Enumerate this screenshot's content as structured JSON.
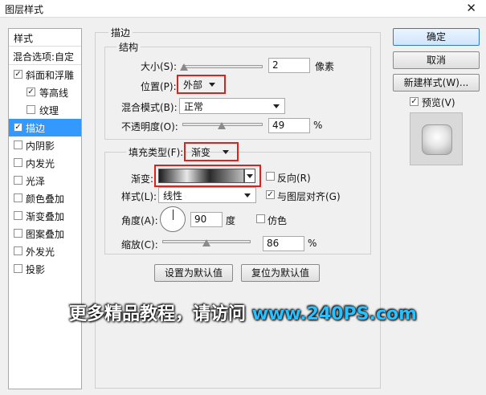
{
  "window": {
    "title": "图层样式",
    "close": "✕"
  },
  "styles_panel": {
    "header": "样式",
    "blend": "混合选项:自定",
    "items": [
      {
        "label": "斜面和浮雕",
        "checked": true,
        "indent": false,
        "selected": false
      },
      {
        "label": "等高线",
        "checked": true,
        "indent": true,
        "selected": false
      },
      {
        "label": "纹理",
        "checked": false,
        "indent": true,
        "selected": false
      },
      {
        "label": "描边",
        "checked": true,
        "indent": false,
        "selected": true
      },
      {
        "label": "内阴影",
        "checked": false,
        "indent": false,
        "selected": false
      },
      {
        "label": "内发光",
        "checked": false,
        "indent": false,
        "selected": false
      },
      {
        "label": "光泽",
        "checked": false,
        "indent": false,
        "selected": false
      },
      {
        "label": "颜色叠加",
        "checked": false,
        "indent": false,
        "selected": false
      },
      {
        "label": "渐变叠加",
        "checked": false,
        "indent": false,
        "selected": false
      },
      {
        "label": "图案叠加",
        "checked": false,
        "indent": false,
        "selected": false
      },
      {
        "label": "外发光",
        "checked": false,
        "indent": false,
        "selected": false
      },
      {
        "label": "投影",
        "checked": false,
        "indent": false,
        "selected": false
      }
    ]
  },
  "stroke": {
    "title": "描边",
    "structure": {
      "title": "结构",
      "size_label": "大小(S):",
      "size_value": "2",
      "size_unit": "像素",
      "position_label": "位置(P):",
      "position_value": "外部",
      "blend_label": "混合模式(B):",
      "blend_value": "正常",
      "opacity_label": "不透明度(O):",
      "opacity_value": "49",
      "opacity_unit": "%"
    },
    "fill": {
      "type_label": "填充类型(F):",
      "type_value": "渐变",
      "gradient_label": "渐变:",
      "reverse_label": "反向(R)",
      "reverse_checked": false,
      "style_label": "样式(L):",
      "style_value": "线性",
      "align_label": "与图层对齐(G)",
      "align_checked": true,
      "angle_label": "角度(A):",
      "angle_value": "90",
      "angle_unit": "度",
      "dither_label": "仿色",
      "dither_checked": false,
      "scale_label": "缩放(C):",
      "scale_value": "86",
      "scale_unit": "%"
    },
    "make_default": "设置为默认值",
    "reset_default": "复位为默认值"
  },
  "buttons": {
    "ok": "确定",
    "cancel": "取消",
    "new_style": "新建样式(W)...",
    "preview_label": "预览(V)",
    "preview_checked": true
  },
  "watermark": {
    "text": "更多精品教程，请访问 ",
    "url": "www.240PS.com"
  }
}
